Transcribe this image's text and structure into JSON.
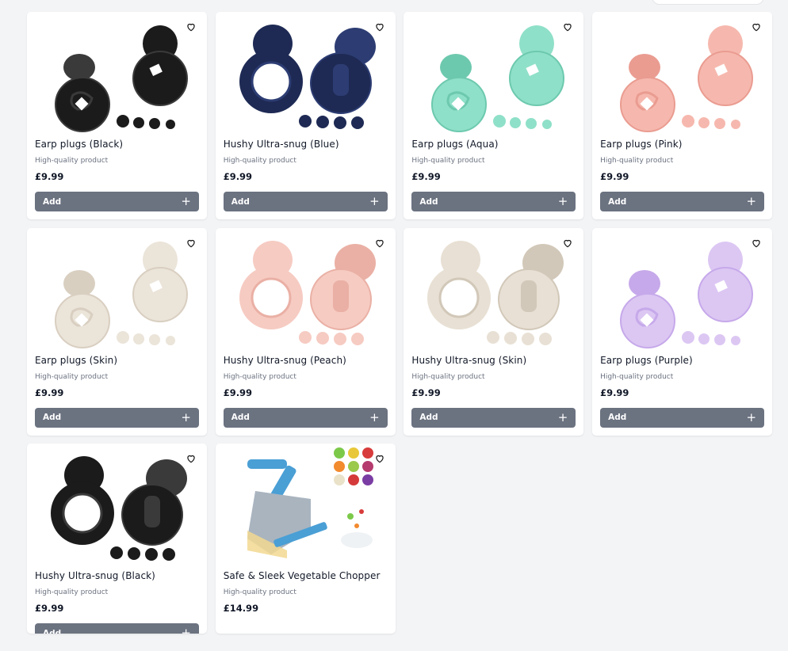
{
  "products": [
    {
      "name": "Earp plugs (Black)",
      "desc": "High-quality product",
      "price": "£9.99",
      "add_label": "Add",
      "color": "#1b1b1b",
      "shade": "#3a3a3a",
      "kind": "earplug-a"
    },
    {
      "name": "Hushy Ultra-snug (Blue)",
      "desc": "High-quality product",
      "price": "£9.99",
      "add_label": "Add",
      "color": "#1e2a54",
      "shade": "#2d3d73",
      "kind": "earplug-b"
    },
    {
      "name": "Earp plugs (Aqua)",
      "desc": "High-quality product",
      "price": "£9.99",
      "add_label": "Add",
      "color": "#8fe0c8",
      "shade": "#6dc9ae",
      "kind": "earplug-a"
    },
    {
      "name": "Earp plugs (Pink)",
      "desc": "High-quality product",
      "price": "£9.99",
      "add_label": "Add",
      "color": "#f6b8ae",
      "shade": "#ea9c91",
      "kind": "earplug-a"
    },
    {
      "name": "Earp plugs (Skin)",
      "desc": "High-quality product",
      "price": "£9.99",
      "add_label": "Add",
      "color": "#ebe4d9",
      "shade": "#d9cfc1",
      "kind": "earplug-a"
    },
    {
      "name": "Hushy Ultra-snug (Peach)",
      "desc": "High-quality product",
      "price": "£9.99",
      "add_label": "Add",
      "color": "#f6cbc2",
      "shade": "#eab0a5",
      "kind": "earplug-b"
    },
    {
      "name": "Hushy Ultra-snug (Skin)",
      "desc": "High-quality product",
      "price": "£9.99",
      "add_label": "Add",
      "color": "#e8e0d4",
      "shade": "#d2c8b9",
      "kind": "earplug-b"
    },
    {
      "name": "Earp plugs (Purple)",
      "desc": "High-quality product",
      "price": "£9.99",
      "add_label": "Add",
      "color": "#dcc7f3",
      "shade": "#c6a9ea",
      "kind": "earplug-a"
    },
    {
      "name": "Hushy Ultra-snug (Black)",
      "desc": "High-quality product",
      "price": "£9.99",
      "add_label": "Add",
      "color": "#1b1b1b",
      "shade": "#3a3a3a",
      "kind": "earplug-b"
    },
    {
      "name": "Safe & Sleek Vegetable Chopper",
      "desc": "High-quality product",
      "price": "£14.99",
      "add_label": "",
      "color": "#4a9fd5",
      "shade": "#a9b4bf",
      "kind": "chopper"
    }
  ],
  "theme": {
    "button_bg": "#6b7280",
    "page_bg": "#f3f4f6"
  }
}
